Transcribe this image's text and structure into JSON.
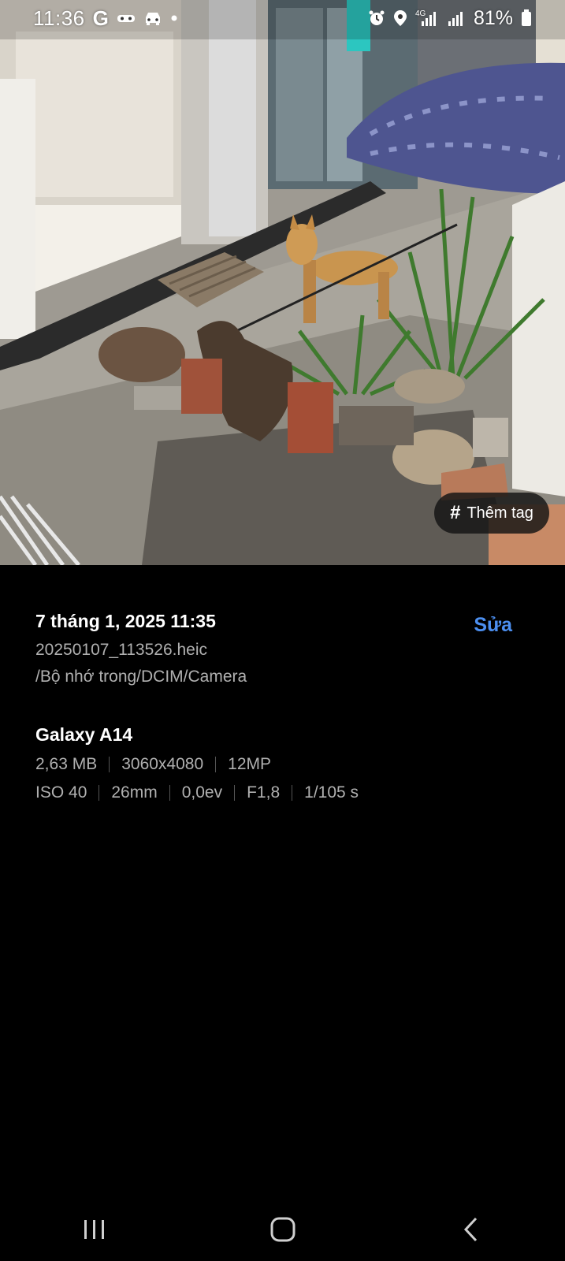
{
  "status_bar": {
    "time": "11:36",
    "google_glyph": "G",
    "network": "4G",
    "battery": "81%",
    "icons": [
      "google-icon",
      "game-icon",
      "car-icon",
      "dot-icon",
      "alarm-icon",
      "location-icon",
      "signal-icon",
      "signal-icon-2",
      "battery-icon"
    ]
  },
  "photo": {
    "description_icon": "photo-image"
  },
  "tag_button": {
    "hash": "#",
    "label": "Thêm tag"
  },
  "details": {
    "date": "7 tháng 1, 2025 11:35",
    "edit_label": "Sửa",
    "filename": "20250107_113526.heic",
    "path": "/Bộ nhớ trong/DCIM/Camera",
    "device": "Galaxy A14",
    "file_info": [
      "2,63 MB",
      "3060x4080",
      "12MP"
    ],
    "exposure": [
      "ISO 40",
      "26mm",
      "0,0ev",
      "F1,8",
      "1/105 s"
    ]
  },
  "colors": {
    "accent": "#4c8ff0",
    "background": "#000000",
    "secondary_text": "#b0b0b0"
  },
  "nav_bar": {
    "icons": [
      "recents-icon",
      "home-icon",
      "back-icon"
    ]
  }
}
